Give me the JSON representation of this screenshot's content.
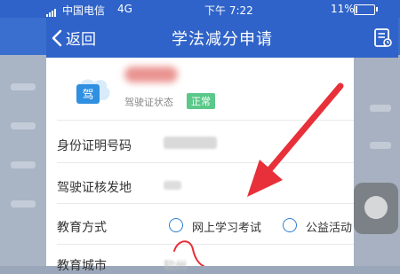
{
  "status_bar": {
    "carrier": "中国电信",
    "network": "4G",
    "time": "下午 7:22",
    "battery_percent": "11%",
    "battery_level": 0.11
  },
  "nav": {
    "back_label": "返回",
    "title": "学法减分申请",
    "back_icon": "chevron-left-icon",
    "action_icon": "document-list-icon"
  },
  "license": {
    "icon_text": "驾",
    "status_label": "驾驶证状态",
    "status_value": "正常",
    "status_color": "#5ac889"
  },
  "form": {
    "id_label": "身份证明号码",
    "issue_place_label": "驾驶证核发地",
    "edu_method_label": "教育方式",
    "edu_options": [
      "网上学习考试",
      "公益活动"
    ],
    "edu_city_label": "教育城市",
    "edu_city_value": "软州"
  },
  "colors": {
    "primary": "#2f63c9",
    "annotation_red": "#e8303a"
  }
}
